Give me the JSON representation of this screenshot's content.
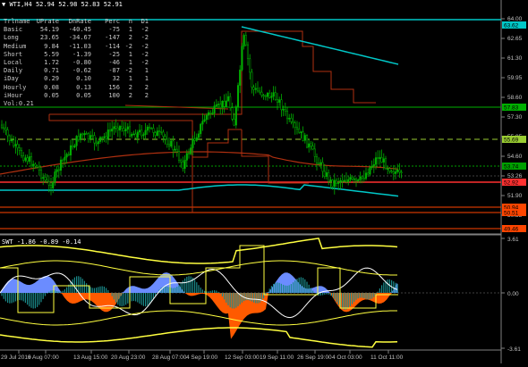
{
  "chart": {
    "symbol": "WTI,H4",
    "ohlc": "52.94 52.98 52.83 52.91",
    "indicator_label": "SWT -1.86 -0.89 -0.14"
  },
  "hud": {
    "columns": [
      "Trlname",
      "UPrate",
      "DnRate",
      "Perc",
      "n",
      "D1"
    ],
    "rows": [
      [
        "Basic",
        "54.19",
        "-40.45",
        "-75",
        "1",
        "-2"
      ],
      [
        "Long",
        "23.65",
        "-34.67",
        "-147",
        "2",
        "-2"
      ],
      [
        "Medium",
        "9.84",
        "-11.03",
        "-114",
        "-2",
        "-2"
      ],
      [
        "Short",
        "5.59",
        "-1.39",
        "-25",
        "1",
        "-2"
      ],
      [
        "Local",
        "1.72",
        "-0.80",
        "-46",
        "1",
        "-2"
      ],
      [
        "Daily",
        "0.71",
        "-0.62",
        "-87",
        "-2",
        "1"
      ],
      [
        "iDay",
        "0.29",
        "0.10",
        "32",
        "1",
        "1"
      ],
      [
        "Hourly",
        "0.08",
        "0.13",
        "156",
        "2",
        "2"
      ],
      [
        "iHour",
        "0.05",
        "0.05",
        "100",
        "2",
        "2"
      ]
    ],
    "footer": "Vol:0.21"
  },
  "price_axis": {
    "ticks": [
      "64.00",
      "62.65",
      "61.30",
      "59.95",
      "58.60",
      "57.30",
      "55.95",
      "54.60",
      "53.26",
      "51.90",
      "50.55"
    ],
    "labels": [
      {
        "text": "63.62",
        "color": "#00c8c8"
      },
      {
        "text": "57.83",
        "color": "#00b000"
      },
      {
        "text": "55.69",
        "color": "#9acd32"
      },
      {
        "text": "53.74",
        "color": "#00a000"
      },
      {
        "text": "52.92",
        "color": "#ff3030"
      },
      {
        "text": "50.94",
        "color": "#ff4500"
      },
      {
        "text": "50.51",
        "color": "#ff4500"
      },
      {
        "text": "49.46",
        "color": "#ff4500"
      }
    ]
  },
  "osc_axis": {
    "ticks": [
      "3.61",
      "0.00",
      "-3.61"
    ]
  },
  "time_axis": {
    "ticks": [
      "29 Jul 2019",
      "6 Aug 07:00",
      "13 Aug 15:00",
      "20 Aug 23:00",
      "28 Aug 07:00",
      "4 Sep 19:00",
      "12 Sep 03:00",
      "19 Sep 11:00",
      "26 Sep 19:00",
      "4 Oct 03:00",
      "11 Oct 11:00"
    ]
  },
  "colors": {
    "candles": "#00b000",
    "ma_cyan": "#00c8c8",
    "ma_red": "#b03010",
    "zero_fill": "#6b8cff",
    "hist_fill": "#1a8a8a",
    "osc_orange": "#ff5a00",
    "osc_yellow": "#ffff40",
    "osc_blue": "#7aa7ff"
  }
}
